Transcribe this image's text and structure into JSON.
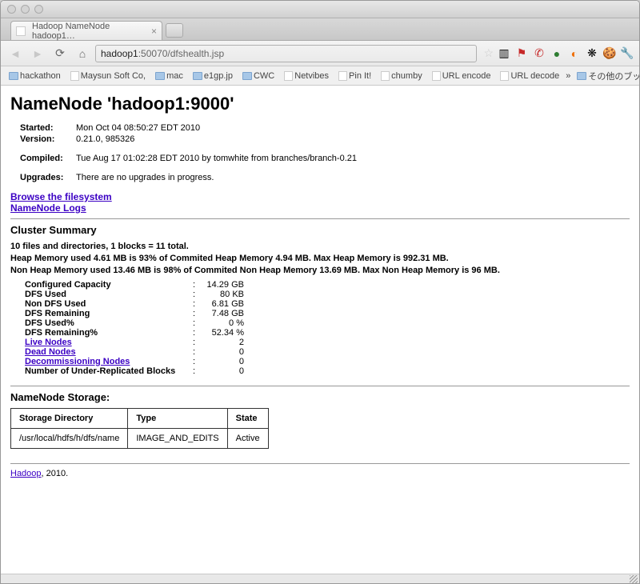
{
  "window": {
    "tab_title": "Hadoop NameNode hadoop1…"
  },
  "toolbar": {
    "url_host": "hadoop1",
    "url_rest": ":50070/dfshealth.jsp"
  },
  "bookmarks": {
    "items": [
      "hackathon",
      "Maysun Soft Co,",
      "mac",
      "e1gp.jp",
      "CWC",
      "Netvibes",
      "Pin It!",
      "chumby",
      "URL encode",
      "URL decode"
    ],
    "more": "»",
    "other": "その他のブックマーク"
  },
  "page": {
    "title": "NameNode 'hadoop1:9000'",
    "meta": {
      "started_lbl": "Started:",
      "started_val": "Mon Oct 04 08:50:27 EDT 2010",
      "version_lbl": "Version:",
      "version_val": "0.21.0, 985326",
      "compiled_lbl": "Compiled:",
      "compiled_val": "Tue Aug 17 01:02:28 EDT 2010 by tomwhite from branches/branch-0.21",
      "upgrades_lbl": "Upgrades:",
      "upgrades_val": "There are no upgrades in progress."
    },
    "links": {
      "browse": "Browse the filesystem",
      "logs": "NameNode Logs"
    },
    "cluster": {
      "heading": "Cluster Summary",
      "line1": "10 files and directories, 1 blocks = 11 total.",
      "line2": "Heap Memory used 4.61 MB is 93% of Commited Heap Memory 4.94 MB. Max Heap Memory is 992.31 MB.",
      "line3": "Non Heap Memory used 13.46 MB is 98% of Commited Non Heap Memory 13.69 MB. Max Non Heap Memory is 96 MB.",
      "rows": [
        {
          "label": "Configured Capacity",
          "value": "14.29 GB",
          "link": false
        },
        {
          "label": "DFS Used",
          "value": "80 KB",
          "link": false
        },
        {
          "label": "Non DFS Used",
          "value": "6.81 GB",
          "link": false
        },
        {
          "label": "DFS Remaining",
          "value": "7.48 GB",
          "link": false
        },
        {
          "label": "DFS Used%",
          "value": "0 %",
          "link": false
        },
        {
          "label": "DFS Remaining%",
          "value": "52.34 %",
          "link": false
        },
        {
          "label": "Live Nodes",
          "value": "2",
          "link": true
        },
        {
          "label": "Dead Nodes",
          "value": "0",
          "link": true
        },
        {
          "label": "Decommissioning Nodes",
          "value": "0",
          "link": true
        },
        {
          "label": "Number of Under-Replicated Blocks",
          "value": "0",
          "link": false
        }
      ]
    },
    "storage": {
      "heading": "NameNode Storage:",
      "headers": [
        "Storage Directory",
        "Type",
        "State"
      ],
      "row": [
        "/usr/local/hdfs/h/dfs/name",
        "IMAGE_AND_EDITS",
        "Active"
      ]
    },
    "footer": {
      "link": "Hadoop",
      "rest": ", 2010."
    }
  }
}
